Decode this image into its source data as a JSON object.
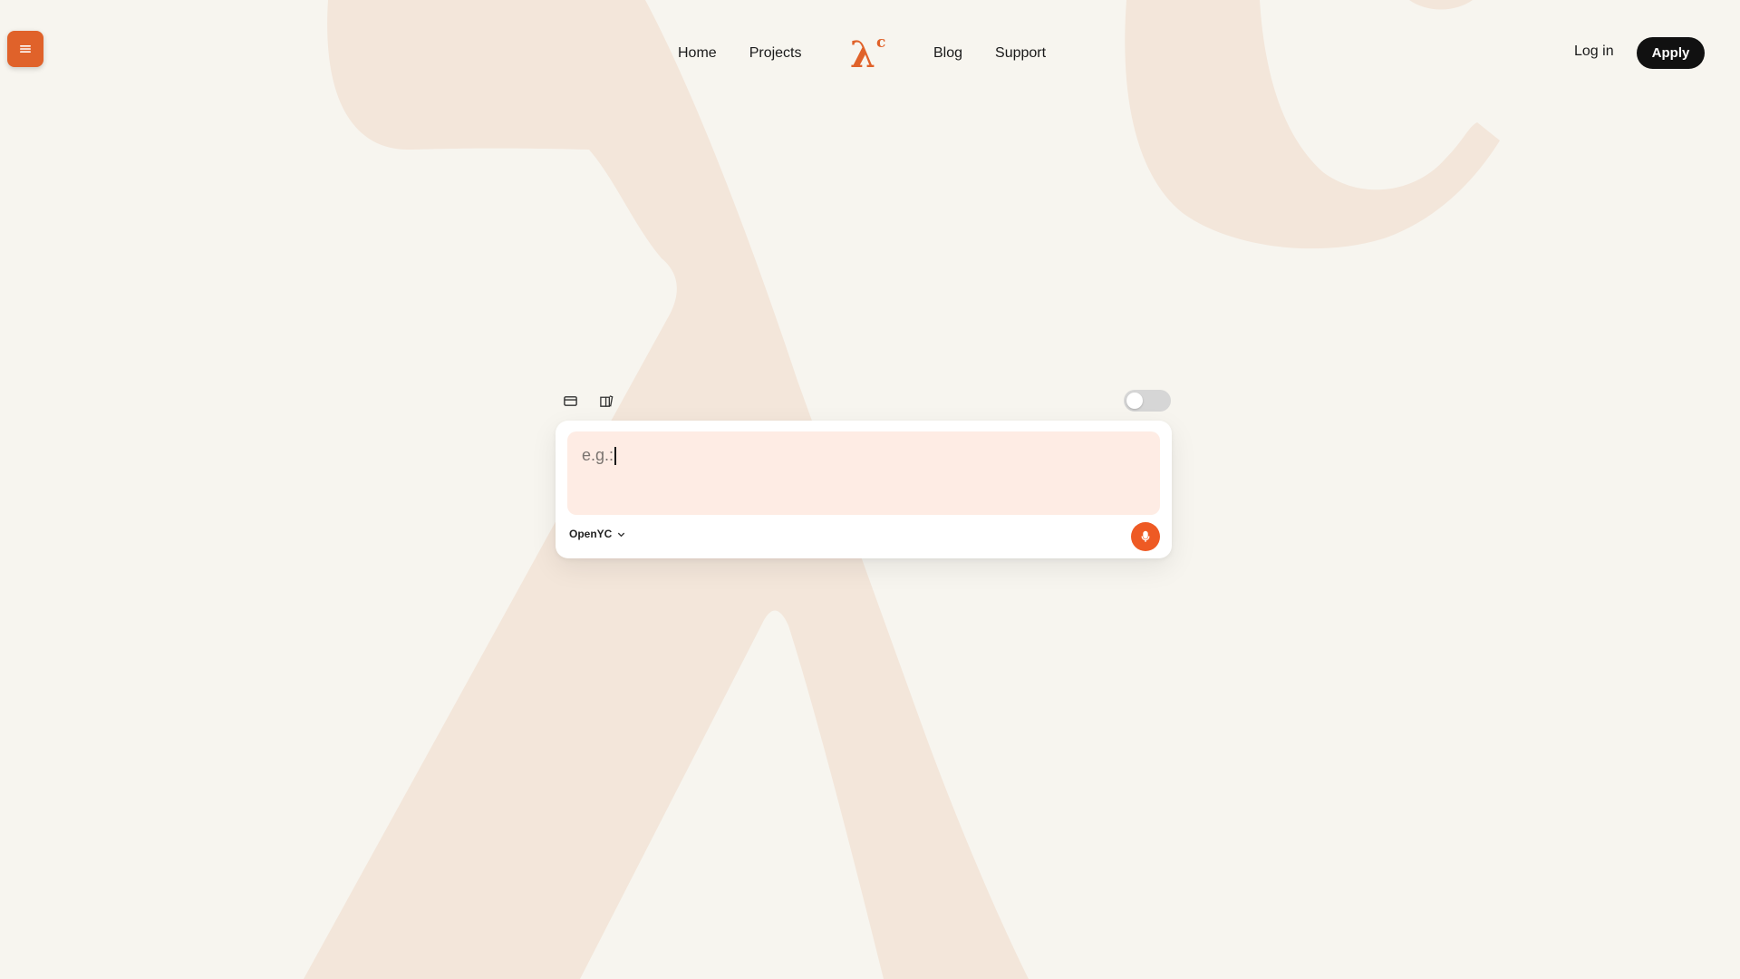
{
  "menu": {
    "icon": "menu-icon"
  },
  "nav": {
    "items_left": [
      "Home",
      "Projects"
    ],
    "items_right": [
      "Blog",
      "Support"
    ],
    "logo_glyph": "λ",
    "logo_superscript": "c"
  },
  "auth": {
    "login_label": "Log in",
    "apply_label": "Apply"
  },
  "toolbar": {
    "icons": [
      "card-icon",
      "book-icon"
    ],
    "toggle_on": false
  },
  "prompt": {
    "text": "e.g.:",
    "model": "OpenYC"
  },
  "colors": {
    "accent": "#e0622a",
    "mic": "#ee5a24",
    "background": "#f7f5ef",
    "watermark": "#f3e6da",
    "prompt_bg": "#feece4",
    "button_dark": "#111111"
  }
}
